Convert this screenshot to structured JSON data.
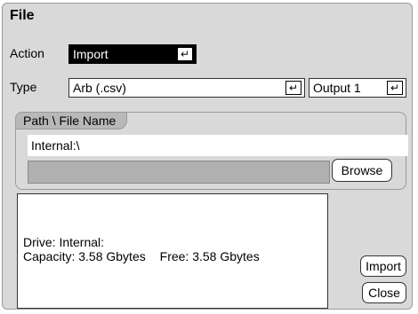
{
  "dialog": {
    "title": "File"
  },
  "action": {
    "label": "Action",
    "value": "Import"
  },
  "type": {
    "label": "Type",
    "value": "Arb (.csv)"
  },
  "output": {
    "value": "Output 1"
  },
  "path": {
    "group_label": "Path \\ File Name",
    "value": "Internal:\\",
    "browse_label": "Browse"
  },
  "info": {
    "drive": "Drive: Internal:",
    "capacity": "Capacity: 3.58 Gbytes",
    "free": "Free: 3.58 Gbytes"
  },
  "buttons": {
    "import_label": "Import",
    "close_label": "Close"
  },
  "icons": {
    "enter": "enter-icon"
  },
  "colors": {
    "background": "#d9d9d9",
    "action_dropdown": "#000000",
    "path_tab": "#b8b8b8"
  }
}
